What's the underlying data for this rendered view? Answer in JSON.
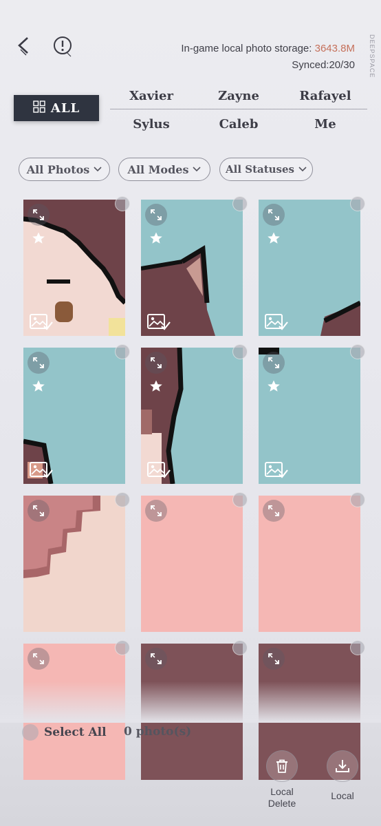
{
  "header": {
    "storage_label": "In-game local photo storage: ",
    "storage_value": "3643.8M",
    "synced": "Synced:20/30",
    "side_text": "DEEPSPACE",
    "back_icon": "chevron-left-icon",
    "alert_icon": "alert-circle-icon"
  },
  "tabs": {
    "all": "ALL",
    "characters": [
      "Xavier",
      "Zayne",
      "Rafayel",
      "Sylus",
      "Caleb",
      "Me"
    ]
  },
  "filters": {
    "photos": "All Photos",
    "modes": "All Modes",
    "statuses": "All Statuses"
  },
  "photos": [
    {
      "bg": "#f2d9d2",
      "starred": true,
      "synced": true
    },
    {
      "bg": "#93c4c9",
      "starred": true,
      "synced": true
    },
    {
      "bg": "#93c4c9",
      "starred": true,
      "synced": true
    },
    {
      "bg": "#93c4c9",
      "starred": true,
      "synced": true
    },
    {
      "bg": "#93c4c9",
      "starred": true,
      "synced": true
    },
    {
      "bg": "#93c4c9",
      "starred": true,
      "synced": true
    },
    {
      "bg": "#f1d6cc",
      "starred": false,
      "synced": false
    },
    {
      "bg": "#f5b7b4",
      "starred": false,
      "synced": false
    },
    {
      "bg": "#f5b7b4",
      "starred": false,
      "synced": false
    },
    {
      "bg": "#f5b7b4",
      "starred": false,
      "synced": false
    },
    {
      "bg": "#7e5258",
      "starred": false,
      "synced": false
    },
    {
      "bg": "#7e5258",
      "starred": false,
      "synced": false
    }
  ],
  "footer": {
    "select_all": "Select All",
    "count": "0 photo(s)",
    "local_delete": "Local Delete",
    "local": "Local"
  },
  "colors": {
    "accent": "#c5705a",
    "tab_active_bg": "#2f3440",
    "sky_blue": "#93c4c9",
    "pink": "#f5b7b4",
    "maroon": "#6e4349"
  }
}
